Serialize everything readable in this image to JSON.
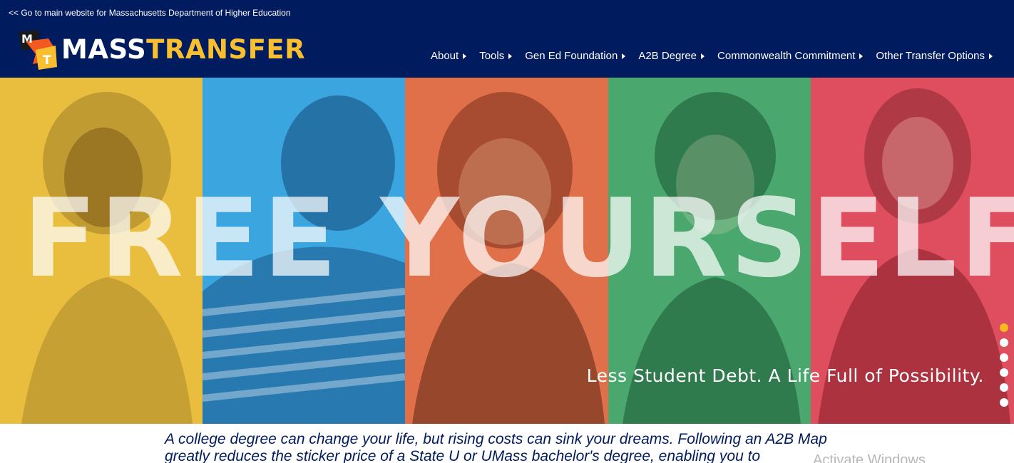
{
  "header": {
    "top_link": "<< Go to main website for Massachusetts Department of Higher Education",
    "logo": {
      "mark_letters": [
        "M",
        "T"
      ],
      "word_part1": "MASS",
      "word_part2": "TRANSFER"
    },
    "nav": [
      {
        "label": "About"
      },
      {
        "label": "Tools"
      },
      {
        "label": "Gen Ed Foundation"
      },
      {
        "label": "A2B Degree"
      },
      {
        "label": "Commonwealth Commitment"
      },
      {
        "label": "Other Transfer Options"
      }
    ]
  },
  "hero": {
    "title": "FREE YOURSELF",
    "tagline": "Less Student Debt. A Life Full of Possibility.",
    "panel_colors": [
      "#e9bd3d",
      "#3aa5df",
      "#e0704a",
      "#4aa86e",
      "#de4e5e"
    ],
    "slides": 6,
    "active_slide": 1
  },
  "intro": {
    "text": "A college degree can change your life, but rising costs can sink your dreams. Following an A2B Map greatly reduces the sticker price of a State U or UMass bachelor's degree, enabling you to"
  },
  "overlay": {
    "watermark": "Activate Windows"
  },
  "colors": {
    "header_bg": "#001b5e",
    "brand_yellow": "#f9bf2f",
    "active_dot": "#f6b91e"
  }
}
